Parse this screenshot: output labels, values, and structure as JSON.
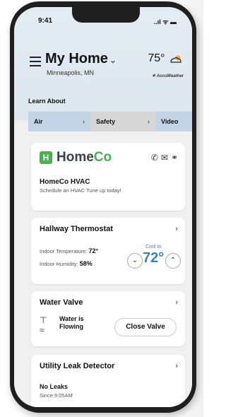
{
  "status_bar": {
    "time": "9:41",
    "icons": "..ıl ᯤ ▬"
  },
  "header": {
    "title": "My Home",
    "subtitle": "Minneapolis, MN",
    "temperature": "75°",
    "weather_brand": "AccuWeather"
  },
  "learn": {
    "heading": "Learn About",
    "tabs": [
      {
        "label": "Air"
      },
      {
        "label": "Safety"
      },
      {
        "label": "Video"
      }
    ]
  },
  "brand_card": {
    "logo_letter": "H",
    "name_part1": "Home",
    "name_part2": "Co",
    "title": "HomeCo HVAC",
    "description": "Schedule an HVAC Tune up today!"
  },
  "thermostat_card": {
    "title": "Hallway Thermostat",
    "indoor_temp_label": "Indoor Temperature:",
    "indoor_temp_value": "72°",
    "indoor_humidity_label": "Indoor Humidity:",
    "indoor_humidity_value": "58%",
    "cool_label": "Cool to",
    "cool_value": "72°"
  },
  "valve_card": {
    "title": "Water Valve",
    "status": "Water is Flowing",
    "button": "Close Valve"
  },
  "leak_card": {
    "title": "Utility Leak Detector",
    "status": "No Leaks",
    "since": "Since 9:05AM"
  },
  "colors": {
    "brand_green": "#4caf50",
    "accent_blue": "#3d7fc4"
  }
}
